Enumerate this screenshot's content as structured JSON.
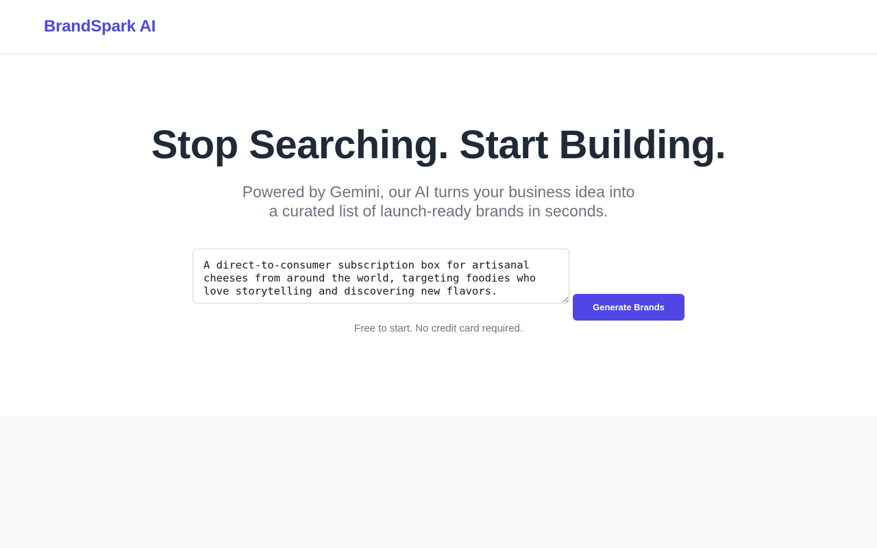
{
  "header": {
    "brand": "BrandSpark AI"
  },
  "hero": {
    "headline": "Stop Searching. Start Building.",
    "subhead_line1": "Powered by Gemini, our AI turns your business idea into",
    "subhead_line2": "a curated list of launch-ready brands in seconds.",
    "idea_input_value": "A direct-to-consumer subscription box for artisanal cheeses from around the world, targeting foodies who love storytelling and discovering new flavors.",
    "generate_label": "Generate Brands",
    "note": "Free to start. No credit card required."
  },
  "colors": {
    "accent": "#4f46e5",
    "headline": "#1f2937",
    "muted": "#6b7280",
    "lower_background": "#f9fafb"
  }
}
